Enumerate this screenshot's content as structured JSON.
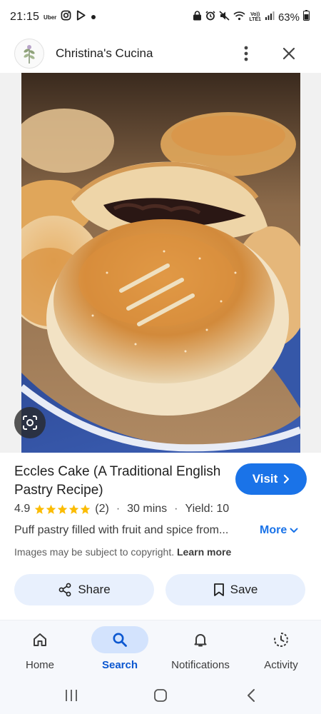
{
  "status_bar": {
    "time": "21:15",
    "uber": "Uber",
    "lte_top": "Vo))",
    "lte_bottom": "LTE1",
    "battery": "63%"
  },
  "header": {
    "site_name": "Christina's Cucina",
    "more_icon": "more-vert-icon",
    "close_icon": "close-icon"
  },
  "result": {
    "title": "Eccles Cake (A Traditional English Pastry Recipe)",
    "visit_label": "Visit",
    "rating": "4.9",
    "stars": 5,
    "reviews": "(2)",
    "time": "30 mins",
    "yield": "Yield: 10",
    "snippet": "Puff pastry filled with fruit and spice from...",
    "more_label": "More",
    "copyright_text": "Images may be subject to copyright.",
    "learn_more": "Learn more",
    "share_label": "Share",
    "save_label": "Save"
  },
  "bottom_nav": {
    "items": [
      {
        "label": "Home",
        "icon": "home-icon"
      },
      {
        "label": "Search",
        "icon": "search-icon"
      },
      {
        "label": "Notifications",
        "icon": "bell-icon"
      },
      {
        "label": "Activity",
        "icon": "activity-icon"
      }
    ],
    "active": "Search"
  },
  "colors": {
    "accent": "#1a73e8",
    "star": "#fbbc04",
    "nav_active_pill": "#d3e3fd",
    "action_button_bg": "#e8f0fd"
  }
}
